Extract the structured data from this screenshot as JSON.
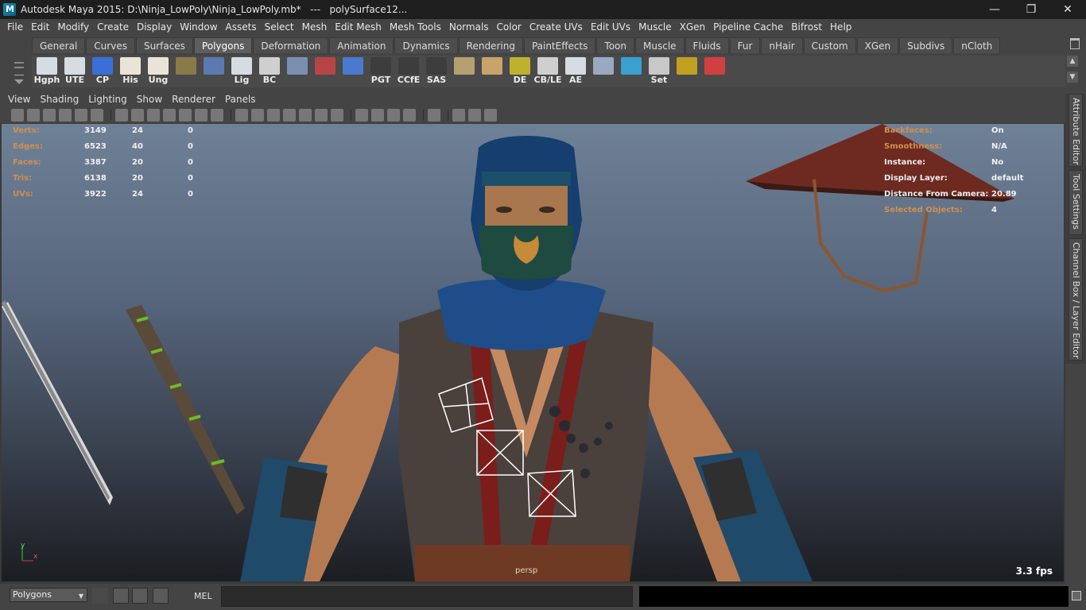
{
  "window": {
    "title": "Autodesk Maya 2015: D:\\Ninja_LowPoly\\Ninja_LowPoly.mb*   ---   polySurface12...",
    "controls": [
      "—",
      "❐",
      "✕"
    ]
  },
  "menubar": [
    "File",
    "Edit",
    "Modify",
    "Create",
    "Display",
    "Window",
    "Assets",
    "Select",
    "Mesh",
    "Edit Mesh",
    "Mesh Tools",
    "Normals",
    "Color",
    "Create UVs",
    "Edit UVs",
    "Muscle",
    "XGen",
    "Pipeline Cache",
    "Bifrost",
    "Help"
  ],
  "shelf": {
    "tabs": [
      "General",
      "Curves",
      "Surfaces",
      "Polygons",
      "Deformation",
      "Animation",
      "Dynamics",
      "Rendering",
      "PaintEffects",
      "Toon",
      "Muscle",
      "Fluids",
      "Fur",
      "nHair",
      "Custom",
      "XGen",
      "Subdivs",
      "nCloth"
    ],
    "active_tab": "Polygons",
    "buttons": [
      {
        "label": "Hgph",
        "icon": "hypergraph-icon"
      },
      {
        "label": "UTE",
        "icon": "uv-texture-editor-icon"
      },
      {
        "label": "CP",
        "icon": "center-pivot-icon"
      },
      {
        "label": "His",
        "icon": "history-icon"
      },
      {
        "label": "Ung",
        "icon": "ungroup-icon"
      },
      {
        "label": "",
        "icon": "book-icon"
      },
      {
        "label": "",
        "icon": "globe-select-icon"
      },
      {
        "label": "Lig",
        "icon": "lighting-icon"
      },
      {
        "label": "BC",
        "icon": "eye-icon"
      },
      {
        "label": "",
        "icon": "manipulator-icon"
      },
      {
        "label": "",
        "icon": "render-icon"
      },
      {
        "label": "",
        "icon": "curve-icon"
      },
      {
        "label": "PGT",
        "icon": "blank-icon"
      },
      {
        "label": "CCfE",
        "icon": "blank-icon"
      },
      {
        "label": "SAS",
        "icon": "blank-icon"
      },
      {
        "label": "",
        "icon": "uv-layout-icon"
      },
      {
        "label": "",
        "icon": "uv-grid-icon"
      },
      {
        "label": "DE",
        "icon": "lights-icon"
      },
      {
        "label": "CB/LE",
        "icon": "eye-icon"
      },
      {
        "label": "AE",
        "icon": "attribute-editor-icon"
      },
      {
        "label": "",
        "icon": "cone-icon"
      },
      {
        "label": "",
        "icon": "swirl-icon"
      },
      {
        "label": "Set",
        "icon": "key-icon"
      },
      {
        "label": "",
        "icon": "target-icon"
      },
      {
        "label": "",
        "icon": "spiral-icon"
      }
    ]
  },
  "panel": {
    "menu": [
      "View",
      "Shading",
      "Lighting",
      "Show",
      "Renderer",
      "Panels"
    ]
  },
  "hud_left": [
    {
      "label": "Verts:",
      "v1": "3149",
      "v2": "24",
      "v3": "0"
    },
    {
      "label": "Edges:",
      "v1": "6523",
      "v2": "40",
      "v3": "0"
    },
    {
      "label": "Faces:",
      "v1": "3387",
      "v2": "20",
      "v3": "0"
    },
    {
      "label": "Tris:",
      "v1": "6138",
      "v2": "20",
      "v3": "0"
    },
    {
      "label": "UVs:",
      "v1": "3922",
      "v2": "24",
      "v3": "0"
    }
  ],
  "hud_right": [
    {
      "label": "Backfaces:",
      "value": "On",
      "orange": true
    },
    {
      "label": "Smoothness:",
      "value": "N/A",
      "orange": true
    },
    {
      "label": "Instance:",
      "value": "No",
      "orange": false
    },
    {
      "label": "Display Layer:",
      "value": "default",
      "orange": false
    },
    {
      "label": "Distance From Camera:",
      "value": "20.89",
      "orange": false
    },
    {
      "label": "Selected Objects:",
      "value": "4",
      "orange": true
    }
  ],
  "viewport": {
    "camera": "persp",
    "fps": "3.3 fps",
    "axis_y": "y",
    "axis_x": "x"
  },
  "side_tabs": [
    "Attribute Editor",
    "Tool Settings",
    "Channel Box / Layer Editor"
  ],
  "cmdline": {
    "mode": "Polygons",
    "mel_label": "MEL"
  },
  "colors": {
    "hud_label": "#d28f4e",
    "viewport_top": "#6f8197",
    "viewport_bottom": "#1b1d21"
  }
}
